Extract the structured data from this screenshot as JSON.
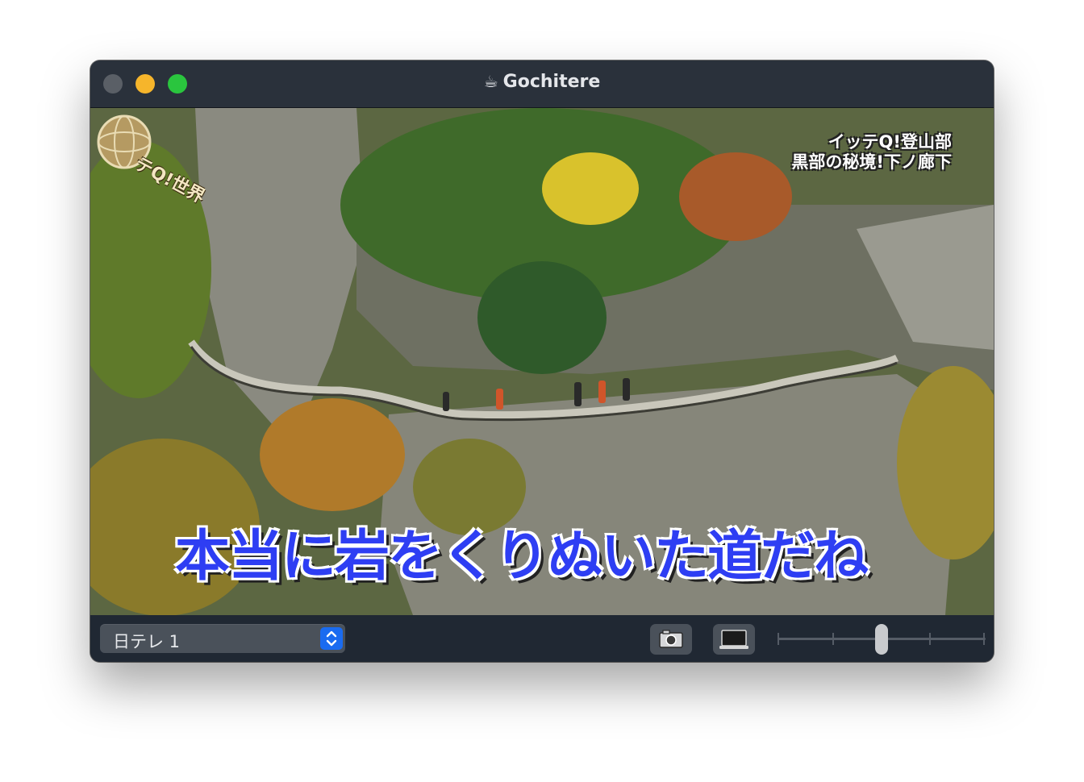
{
  "window": {
    "title": "Gochitere",
    "title_icon": "coffee-cup-icon"
  },
  "video": {
    "logo_text": "テQ!世界",
    "caption_line1": "イッテQ!登山部",
    "caption_line2": "黒部の秘境!下ノ廊下",
    "subtitle": "本当に岩をくりぬいた道だね"
  },
  "toolbar": {
    "channel_selected": "日テレ 1",
    "screenshot_icon": "camera-icon",
    "pip_icon": "picture-in-picture-icon",
    "volume_level": 0.5
  },
  "colors": {
    "subtitle": "#2e3ef3",
    "stepper_accent": "#1a6bf0",
    "close": "#5a5f66",
    "minimize": "#f6b52b",
    "maximize": "#2ac53e"
  }
}
